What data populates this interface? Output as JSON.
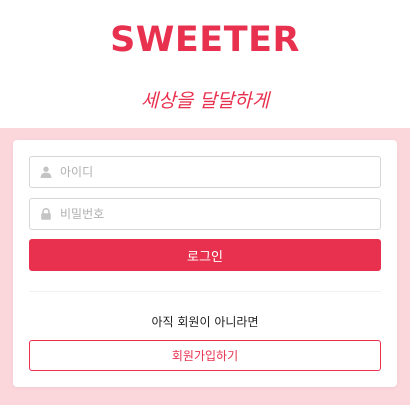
{
  "brand": {
    "logo": "SWEETER",
    "tagline": "세상을 달달하게",
    "accent_color": "#e8314f",
    "background_color": "#fbd7dc"
  },
  "login_form": {
    "id_field": {
      "placeholder": "아이디",
      "value": "",
      "icon": "user-icon"
    },
    "password_field": {
      "placeholder": "비밀번호",
      "value": "",
      "icon": "lock-icon"
    },
    "login_label": "로그인"
  },
  "signup": {
    "notice": "아직 회원이 아니라면",
    "button_label": "회원가입하기"
  }
}
